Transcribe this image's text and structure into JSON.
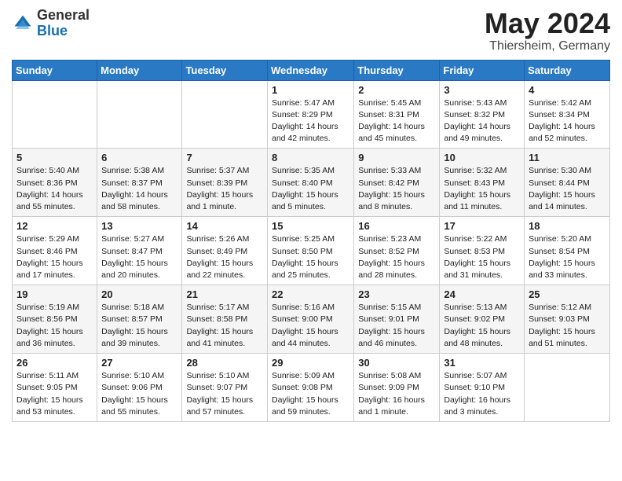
{
  "header": {
    "logo_general": "General",
    "logo_blue": "Blue",
    "title": "May 2024",
    "location": "Thiersheim, Germany"
  },
  "days_of_week": [
    "Sunday",
    "Monday",
    "Tuesday",
    "Wednesday",
    "Thursday",
    "Friday",
    "Saturday"
  ],
  "weeks": [
    [
      {
        "day": "",
        "info": ""
      },
      {
        "day": "",
        "info": ""
      },
      {
        "day": "",
        "info": ""
      },
      {
        "day": "1",
        "info": "Sunrise: 5:47 AM\nSunset: 8:29 PM\nDaylight: 14 hours\nand 42 minutes."
      },
      {
        "day": "2",
        "info": "Sunrise: 5:45 AM\nSunset: 8:31 PM\nDaylight: 14 hours\nand 45 minutes."
      },
      {
        "day": "3",
        "info": "Sunrise: 5:43 AM\nSunset: 8:32 PM\nDaylight: 14 hours\nand 49 minutes."
      },
      {
        "day": "4",
        "info": "Sunrise: 5:42 AM\nSunset: 8:34 PM\nDaylight: 14 hours\nand 52 minutes."
      }
    ],
    [
      {
        "day": "5",
        "info": "Sunrise: 5:40 AM\nSunset: 8:36 PM\nDaylight: 14 hours\nand 55 minutes."
      },
      {
        "day": "6",
        "info": "Sunrise: 5:38 AM\nSunset: 8:37 PM\nDaylight: 14 hours\nand 58 minutes."
      },
      {
        "day": "7",
        "info": "Sunrise: 5:37 AM\nSunset: 8:39 PM\nDaylight: 15 hours\nand 1 minute."
      },
      {
        "day": "8",
        "info": "Sunrise: 5:35 AM\nSunset: 8:40 PM\nDaylight: 15 hours\nand 5 minutes."
      },
      {
        "day": "9",
        "info": "Sunrise: 5:33 AM\nSunset: 8:42 PM\nDaylight: 15 hours\nand 8 minutes."
      },
      {
        "day": "10",
        "info": "Sunrise: 5:32 AM\nSunset: 8:43 PM\nDaylight: 15 hours\nand 11 minutes."
      },
      {
        "day": "11",
        "info": "Sunrise: 5:30 AM\nSunset: 8:44 PM\nDaylight: 15 hours\nand 14 minutes."
      }
    ],
    [
      {
        "day": "12",
        "info": "Sunrise: 5:29 AM\nSunset: 8:46 PM\nDaylight: 15 hours\nand 17 minutes."
      },
      {
        "day": "13",
        "info": "Sunrise: 5:27 AM\nSunset: 8:47 PM\nDaylight: 15 hours\nand 20 minutes."
      },
      {
        "day": "14",
        "info": "Sunrise: 5:26 AM\nSunset: 8:49 PM\nDaylight: 15 hours\nand 22 minutes."
      },
      {
        "day": "15",
        "info": "Sunrise: 5:25 AM\nSunset: 8:50 PM\nDaylight: 15 hours\nand 25 minutes."
      },
      {
        "day": "16",
        "info": "Sunrise: 5:23 AM\nSunset: 8:52 PM\nDaylight: 15 hours\nand 28 minutes."
      },
      {
        "day": "17",
        "info": "Sunrise: 5:22 AM\nSunset: 8:53 PM\nDaylight: 15 hours\nand 31 minutes."
      },
      {
        "day": "18",
        "info": "Sunrise: 5:20 AM\nSunset: 8:54 PM\nDaylight: 15 hours\nand 33 minutes."
      }
    ],
    [
      {
        "day": "19",
        "info": "Sunrise: 5:19 AM\nSunset: 8:56 PM\nDaylight: 15 hours\nand 36 minutes."
      },
      {
        "day": "20",
        "info": "Sunrise: 5:18 AM\nSunset: 8:57 PM\nDaylight: 15 hours\nand 39 minutes."
      },
      {
        "day": "21",
        "info": "Sunrise: 5:17 AM\nSunset: 8:58 PM\nDaylight: 15 hours\nand 41 minutes."
      },
      {
        "day": "22",
        "info": "Sunrise: 5:16 AM\nSunset: 9:00 PM\nDaylight: 15 hours\nand 44 minutes."
      },
      {
        "day": "23",
        "info": "Sunrise: 5:15 AM\nSunset: 9:01 PM\nDaylight: 15 hours\nand 46 minutes."
      },
      {
        "day": "24",
        "info": "Sunrise: 5:13 AM\nSunset: 9:02 PM\nDaylight: 15 hours\nand 48 minutes."
      },
      {
        "day": "25",
        "info": "Sunrise: 5:12 AM\nSunset: 9:03 PM\nDaylight: 15 hours\nand 51 minutes."
      }
    ],
    [
      {
        "day": "26",
        "info": "Sunrise: 5:11 AM\nSunset: 9:05 PM\nDaylight: 15 hours\nand 53 minutes."
      },
      {
        "day": "27",
        "info": "Sunrise: 5:10 AM\nSunset: 9:06 PM\nDaylight: 15 hours\nand 55 minutes."
      },
      {
        "day": "28",
        "info": "Sunrise: 5:10 AM\nSunset: 9:07 PM\nDaylight: 15 hours\nand 57 minutes."
      },
      {
        "day": "29",
        "info": "Sunrise: 5:09 AM\nSunset: 9:08 PM\nDaylight: 15 hours\nand 59 minutes."
      },
      {
        "day": "30",
        "info": "Sunrise: 5:08 AM\nSunset: 9:09 PM\nDaylight: 16 hours\nand 1 minute."
      },
      {
        "day": "31",
        "info": "Sunrise: 5:07 AM\nSunset: 9:10 PM\nDaylight: 16 hours\nand 3 minutes."
      },
      {
        "day": "",
        "info": ""
      }
    ]
  ]
}
